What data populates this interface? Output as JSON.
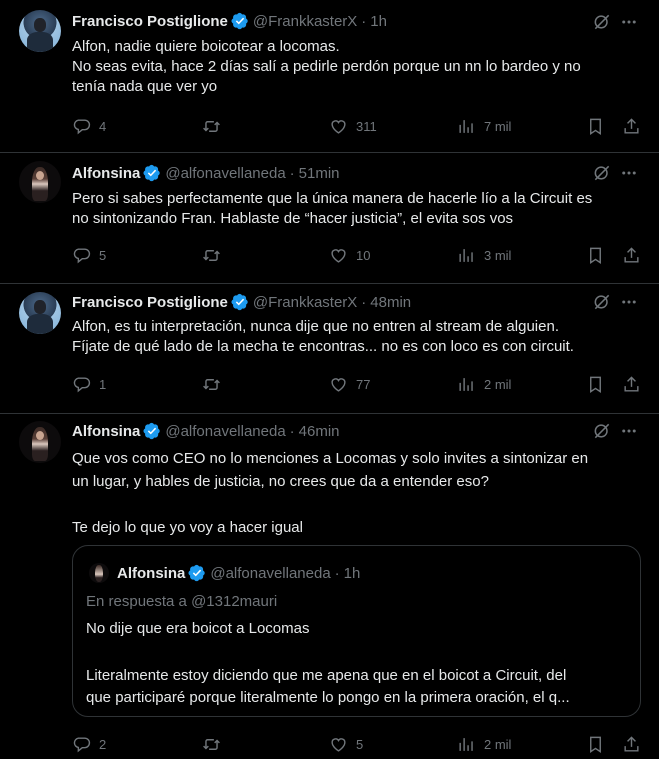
{
  "tweets": [
    {
      "name": "Francisco Postiglione",
      "handle": "@FrankkasterX",
      "time": "1h",
      "lines": [
        "Alfon, nadie quiere boicotear a locomas.",
        "No seas evita, hace 2 días salí a pedirle perdón porque un nn lo bardeo y no",
        "tenía nada que ver yo"
      ],
      "replies": "4",
      "retweets": "",
      "likes": "311",
      "views": "7 mil"
    },
    {
      "name": "Alfonsina",
      "handle": "@alfonavellaneda",
      "time": "51min",
      "lines": [
        "Pero si sabes perfectamente que la única manera de hacerle lío a la Circuit es",
        "no sintonizando Fran. Hablaste de “hacer justicia”, el evita sos vos"
      ],
      "replies": "5",
      "retweets": "",
      "likes": "10",
      "views": "3 mil"
    },
    {
      "name": "Francisco Postiglione",
      "handle": "@FrankkasterX",
      "time": "48min",
      "lines": [
        "Alfon, es tu interpretación, nunca dije que no entren al stream de alguien.",
        "Fíjate de qué lado de la mecha te encontras... no es con loco es con circuit."
      ],
      "replies": "1",
      "retweets": "",
      "likes": "77",
      "views": "2 mil"
    },
    {
      "name": "Alfonsina",
      "handle": "@alfonavellaneda",
      "time": "46min",
      "lines": [
        "Que vos como CEO no lo menciones a Locomas y solo invites a sintonizar en",
        "un lugar, y hables de justicia, no crees que da a entender eso?",
        "",
        "Te dejo lo que yo voy a hacer igual"
      ],
      "replies": "2",
      "retweets": "",
      "likes": "5",
      "views": "2 mil"
    }
  ],
  "quote": {
    "name": "Alfonsina",
    "handle": "@alfonavellaneda",
    "time": "1h",
    "reply_prefix": "En respuesta a",
    "reply_to": "@1312mauri",
    "text1": "No dije que era boicot a Locomas",
    "text2_line1": "Literalmente estoy diciendo que me apena que en el boicot a Circuit, del",
    "text2_line2": "que participaré porque literalmente lo pongo en la primera oración, el q..."
  },
  "separator": "·",
  "colors": {
    "background": "#000000",
    "text": "#e7e9ea",
    "secondary": "#71767b",
    "verified": "#1d9bf0",
    "border": "#2f3336"
  },
  "icons": [
    "verified-badge-icon",
    "grok-icon",
    "more-icon",
    "reply-icon",
    "retweet-icon",
    "like-icon",
    "views-icon",
    "bookmark-icon",
    "share-icon"
  ]
}
